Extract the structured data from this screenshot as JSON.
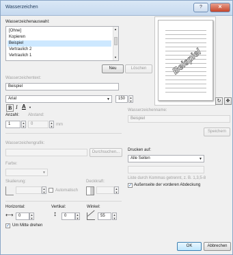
{
  "window": {
    "title": "Wasserzeichen",
    "help": "?",
    "close": "✕"
  },
  "selection": {
    "label": "Wasserzeichenauswahl:",
    "items": [
      "[Ohne]",
      "Kopieren",
      "Beispiel",
      "Vertraulich 2",
      "Vertraulich 1"
    ],
    "selected_index": 2,
    "new_button": "Neu",
    "delete_button": "Löschen"
  },
  "text": {
    "label": "Wasserzeichentext:",
    "value": "Beispiel",
    "font": "Arial",
    "size": "150"
  },
  "format": {
    "bold": "B",
    "italic": "I",
    "color": "A"
  },
  "count": {
    "label": "Anzahl:",
    "value": "1",
    "spacing_label": "Abstand:",
    "spacing_value": "0",
    "unit": "mm"
  },
  "graphic": {
    "label": "Wasserzeichengrafik:",
    "browse": "Durchsuchen...",
    "color_label": "Farbe:",
    "scale_label": "Skalierung:",
    "auto_label": "Automatisch",
    "opacity_label": "Deckkraft:"
  },
  "position": {
    "horizontal_label": "Horizontal:",
    "horizontal_value": "0",
    "vertical_label": "Vertikal:",
    "vertical_value": "0",
    "angle_label": "Winkel:",
    "angle_value": "55",
    "rotate_center_label": "Um Mitte drehen"
  },
  "preview": {
    "text": "Beispiel"
  },
  "name": {
    "label": "Wasserzeichenname:",
    "value": "Beispiel",
    "save": "Speichern"
  },
  "print": {
    "label": "Drucken auf:",
    "value": "Alle Seiten",
    "hint": "Liste durch Kommas getrennt, z. B. 1,3,5-8",
    "outside_label": "Außenseite der vorderen Abdeckung"
  },
  "footer": {
    "ok": "OK",
    "cancel": "Abbrechen"
  }
}
